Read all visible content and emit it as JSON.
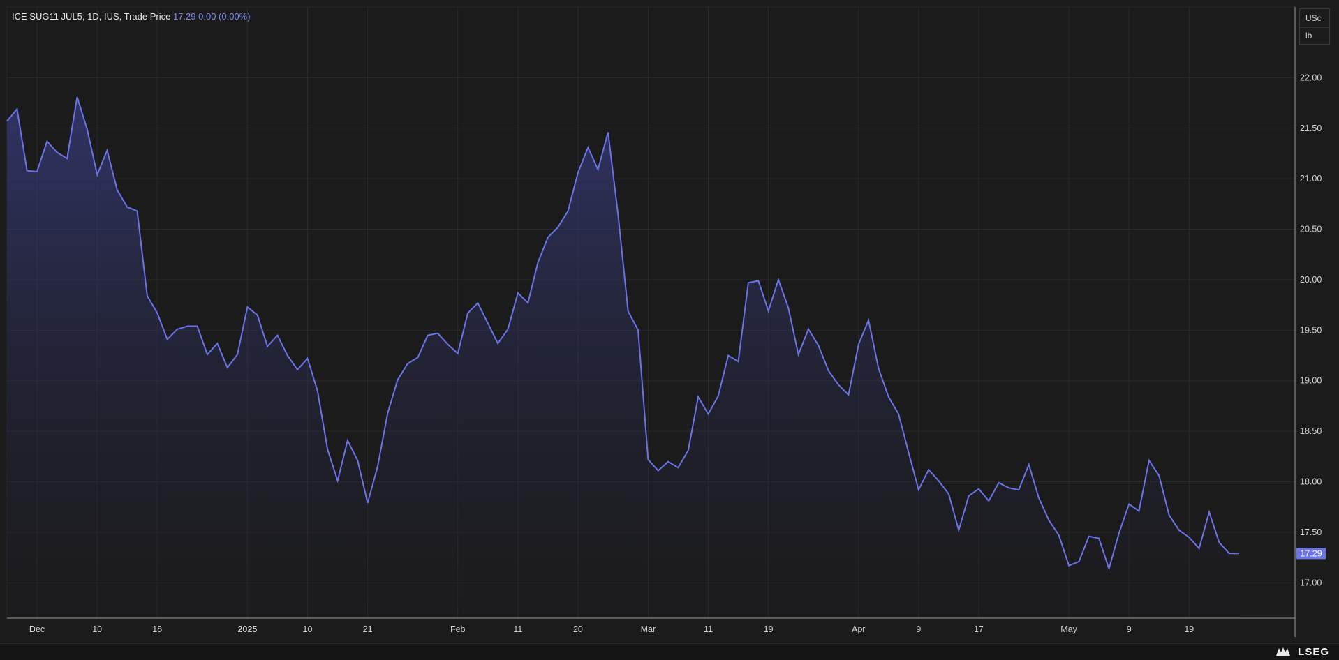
{
  "legend": {
    "instrument": "ICE SUG11 JUL5, 1D, IUS, Trade Price",
    "last": "17.29",
    "change": "0.00 (0.00%)"
  },
  "units": {
    "currency": "USc",
    "measure": "lb"
  },
  "brand": {
    "name": "LSEG"
  },
  "colors": {
    "line": "#6b74e6",
    "background": "#1b1b1b",
    "grid": "#2b2b2b",
    "axis_text": "#d2d2d2"
  },
  "chart_data": {
    "type": "area",
    "title": "",
    "xlabel": "",
    "ylabel": "",
    "grid": true,
    "ylim": [
      16.65,
      22.7
    ],
    "y_ticks": [
      "17.00",
      "17.50",
      "18.00",
      "18.50",
      "19.00",
      "19.50",
      "20.00",
      "20.50",
      "21.00",
      "21.50",
      "22.00"
    ],
    "x_tick_labels": [
      {
        "label": "Dec",
        "i": 3,
        "bold": false
      },
      {
        "label": "10",
        "i": 9,
        "bold": false
      },
      {
        "label": "18",
        "i": 15,
        "bold": false
      },
      {
        "label": "2025",
        "i": 24,
        "bold": true
      },
      {
        "label": "10",
        "i": 30,
        "bold": false
      },
      {
        "label": "21",
        "i": 36,
        "bold": false
      },
      {
        "label": "Feb",
        "i": 45,
        "bold": false
      },
      {
        "label": "11",
        "i": 51,
        "bold": false
      },
      {
        "label": "20",
        "i": 57,
        "bold": false
      },
      {
        "label": "Mar",
        "i": 64,
        "bold": false
      },
      {
        "label": "11",
        "i": 70,
        "bold": false
      },
      {
        "label": "19",
        "i": 76,
        "bold": false
      },
      {
        "label": "Apr",
        "i": 85,
        "bold": false
      },
      {
        "label": "9",
        "i": 91,
        "bold": false
      },
      {
        "label": "17",
        "i": 97,
        "bold": false
      },
      {
        "label": "May",
        "i": 106,
        "bold": false
      },
      {
        "label": "9",
        "i": 112,
        "bold": false
      },
      {
        "label": "19",
        "i": 118,
        "bold": false
      }
    ],
    "last_value_label": "17.29",
    "series": [
      {
        "values": [
          21.57,
          21.69,
          21.08,
          21.07,
          21.37,
          21.26,
          21.2,
          21.81,
          21.49,
          21.04,
          21.28,
          20.89,
          20.72,
          20.68,
          19.84,
          19.67,
          19.41,
          19.51,
          19.54,
          19.54,
          19.26,
          19.37,
          19.13,
          19.26,
          19.73,
          19.65,
          19.34,
          19.45,
          19.25,
          19.11,
          19.22,
          18.9,
          18.32,
          18.01,
          18.41,
          18.21,
          17.79,
          18.15,
          18.68,
          19.01,
          19.17,
          19.23,
          19.45,
          19.47,
          19.36,
          19.27,
          19.67,
          19.77,
          19.57,
          19.37,
          19.51,
          19.87,
          19.77,
          20.17,
          20.42,
          20.52,
          20.68,
          21.06,
          21.31,
          21.09,
          21.46,
          20.64,
          19.69,
          19.5,
          18.22,
          18.11,
          18.2,
          18.14,
          18.31,
          18.84,
          18.67,
          18.85,
          19.25,
          19.19,
          19.97,
          19.99,
          19.69,
          20.0,
          19.72,
          19.26,
          19.51,
          19.35,
          19.1,
          18.96,
          18.86,
          19.36,
          19.6,
          19.12,
          18.84,
          18.67,
          18.29,
          17.92,
          18.12,
          18.01,
          17.88,
          17.52,
          17.86,
          17.93,
          17.81,
          17.99,
          17.94,
          17.92,
          18.17,
          17.84,
          17.62,
          17.47,
          17.17,
          17.21,
          17.46,
          17.44,
          17.14,
          17.49,
          17.78,
          17.71,
          18.21,
          18.06,
          17.67,
          17.52,
          17.45,
          17.34,
          17.7,
          17.4,
          17.29,
          17.29
        ]
      }
    ]
  }
}
